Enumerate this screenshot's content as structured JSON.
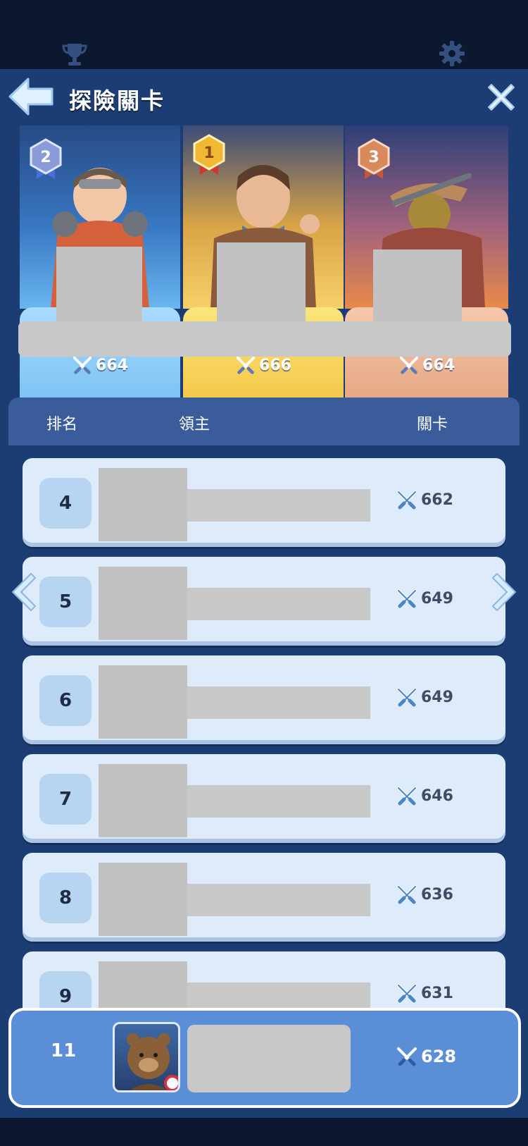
{
  "header": {
    "title": "探險關卡"
  },
  "podium": [
    {
      "rank": "2",
      "stage": "664",
      "medal_color": "#8a9bd9"
    },
    {
      "rank": "1",
      "stage": "666",
      "medal_color": "#f1b933"
    },
    {
      "rank": "3",
      "stage": "664",
      "medal_color": "#d88a5c"
    }
  ],
  "table": {
    "col_rank": "排名",
    "col_lord": "領主",
    "col_level": "關卡",
    "rows": [
      {
        "rank": "4",
        "stage": "662"
      },
      {
        "rank": "5",
        "stage": "649"
      },
      {
        "rank": "6",
        "stage": "649"
      },
      {
        "rank": "7",
        "stage": "646"
      },
      {
        "rank": "8",
        "stage": "636"
      },
      {
        "rank": "9",
        "stage": "631"
      }
    ]
  },
  "my_entry": {
    "rank": "11",
    "stage": "628"
  },
  "icons": [
    "trophy-icon",
    "gear-icon",
    "back-arrow-icon",
    "close-icon",
    "crossed-swords-icon",
    "chevron-left-icon",
    "chevron-right-icon"
  ]
}
